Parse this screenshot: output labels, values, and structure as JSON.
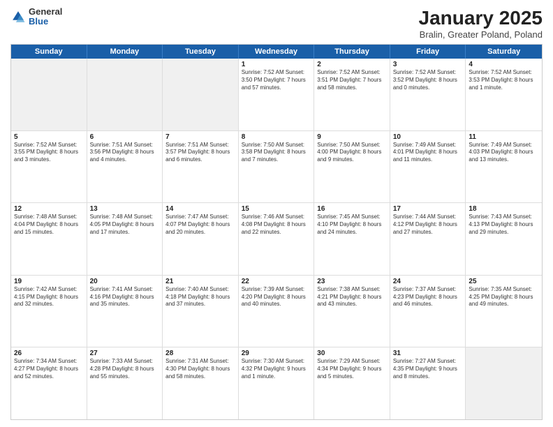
{
  "logo": {
    "general": "General",
    "blue": "Blue"
  },
  "header": {
    "title": "January 2025",
    "subtitle": "Bralin, Greater Poland, Poland"
  },
  "days": [
    "Sunday",
    "Monday",
    "Tuesday",
    "Wednesday",
    "Thursday",
    "Friday",
    "Saturday"
  ],
  "weeks": [
    [
      {
        "day": "",
        "text": "",
        "shaded": true
      },
      {
        "day": "",
        "text": "",
        "shaded": true
      },
      {
        "day": "",
        "text": "",
        "shaded": true
      },
      {
        "day": "1",
        "text": "Sunrise: 7:52 AM\nSunset: 3:50 PM\nDaylight: 7 hours and 57 minutes."
      },
      {
        "day": "2",
        "text": "Sunrise: 7:52 AM\nSunset: 3:51 PM\nDaylight: 7 hours and 58 minutes."
      },
      {
        "day": "3",
        "text": "Sunrise: 7:52 AM\nSunset: 3:52 PM\nDaylight: 8 hours and 0 minutes."
      },
      {
        "day": "4",
        "text": "Sunrise: 7:52 AM\nSunset: 3:53 PM\nDaylight: 8 hours and 1 minute."
      }
    ],
    [
      {
        "day": "5",
        "text": "Sunrise: 7:52 AM\nSunset: 3:55 PM\nDaylight: 8 hours and 3 minutes."
      },
      {
        "day": "6",
        "text": "Sunrise: 7:51 AM\nSunset: 3:56 PM\nDaylight: 8 hours and 4 minutes."
      },
      {
        "day": "7",
        "text": "Sunrise: 7:51 AM\nSunset: 3:57 PM\nDaylight: 8 hours and 6 minutes."
      },
      {
        "day": "8",
        "text": "Sunrise: 7:50 AM\nSunset: 3:58 PM\nDaylight: 8 hours and 7 minutes."
      },
      {
        "day": "9",
        "text": "Sunrise: 7:50 AM\nSunset: 4:00 PM\nDaylight: 8 hours and 9 minutes."
      },
      {
        "day": "10",
        "text": "Sunrise: 7:49 AM\nSunset: 4:01 PM\nDaylight: 8 hours and 11 minutes."
      },
      {
        "day": "11",
        "text": "Sunrise: 7:49 AM\nSunset: 4:03 PM\nDaylight: 8 hours and 13 minutes."
      }
    ],
    [
      {
        "day": "12",
        "text": "Sunrise: 7:48 AM\nSunset: 4:04 PM\nDaylight: 8 hours and 15 minutes."
      },
      {
        "day": "13",
        "text": "Sunrise: 7:48 AM\nSunset: 4:05 PM\nDaylight: 8 hours and 17 minutes."
      },
      {
        "day": "14",
        "text": "Sunrise: 7:47 AM\nSunset: 4:07 PM\nDaylight: 8 hours and 20 minutes."
      },
      {
        "day": "15",
        "text": "Sunrise: 7:46 AM\nSunset: 4:08 PM\nDaylight: 8 hours and 22 minutes."
      },
      {
        "day": "16",
        "text": "Sunrise: 7:45 AM\nSunset: 4:10 PM\nDaylight: 8 hours and 24 minutes."
      },
      {
        "day": "17",
        "text": "Sunrise: 7:44 AM\nSunset: 4:12 PM\nDaylight: 8 hours and 27 minutes."
      },
      {
        "day": "18",
        "text": "Sunrise: 7:43 AM\nSunset: 4:13 PM\nDaylight: 8 hours and 29 minutes."
      }
    ],
    [
      {
        "day": "19",
        "text": "Sunrise: 7:42 AM\nSunset: 4:15 PM\nDaylight: 8 hours and 32 minutes."
      },
      {
        "day": "20",
        "text": "Sunrise: 7:41 AM\nSunset: 4:16 PM\nDaylight: 8 hours and 35 minutes."
      },
      {
        "day": "21",
        "text": "Sunrise: 7:40 AM\nSunset: 4:18 PM\nDaylight: 8 hours and 37 minutes."
      },
      {
        "day": "22",
        "text": "Sunrise: 7:39 AM\nSunset: 4:20 PM\nDaylight: 8 hours and 40 minutes."
      },
      {
        "day": "23",
        "text": "Sunrise: 7:38 AM\nSunset: 4:21 PM\nDaylight: 8 hours and 43 minutes."
      },
      {
        "day": "24",
        "text": "Sunrise: 7:37 AM\nSunset: 4:23 PM\nDaylight: 8 hours and 46 minutes."
      },
      {
        "day": "25",
        "text": "Sunrise: 7:35 AM\nSunset: 4:25 PM\nDaylight: 8 hours and 49 minutes."
      }
    ],
    [
      {
        "day": "26",
        "text": "Sunrise: 7:34 AM\nSunset: 4:27 PM\nDaylight: 8 hours and 52 minutes."
      },
      {
        "day": "27",
        "text": "Sunrise: 7:33 AM\nSunset: 4:28 PM\nDaylight: 8 hours and 55 minutes."
      },
      {
        "day": "28",
        "text": "Sunrise: 7:31 AM\nSunset: 4:30 PM\nDaylight: 8 hours and 58 minutes."
      },
      {
        "day": "29",
        "text": "Sunrise: 7:30 AM\nSunset: 4:32 PM\nDaylight: 9 hours and 1 minute."
      },
      {
        "day": "30",
        "text": "Sunrise: 7:29 AM\nSunset: 4:34 PM\nDaylight: 9 hours and 5 minutes."
      },
      {
        "day": "31",
        "text": "Sunrise: 7:27 AM\nSunset: 4:35 PM\nDaylight: 9 hours and 8 minutes."
      },
      {
        "day": "",
        "text": "",
        "shaded": true
      }
    ]
  ]
}
